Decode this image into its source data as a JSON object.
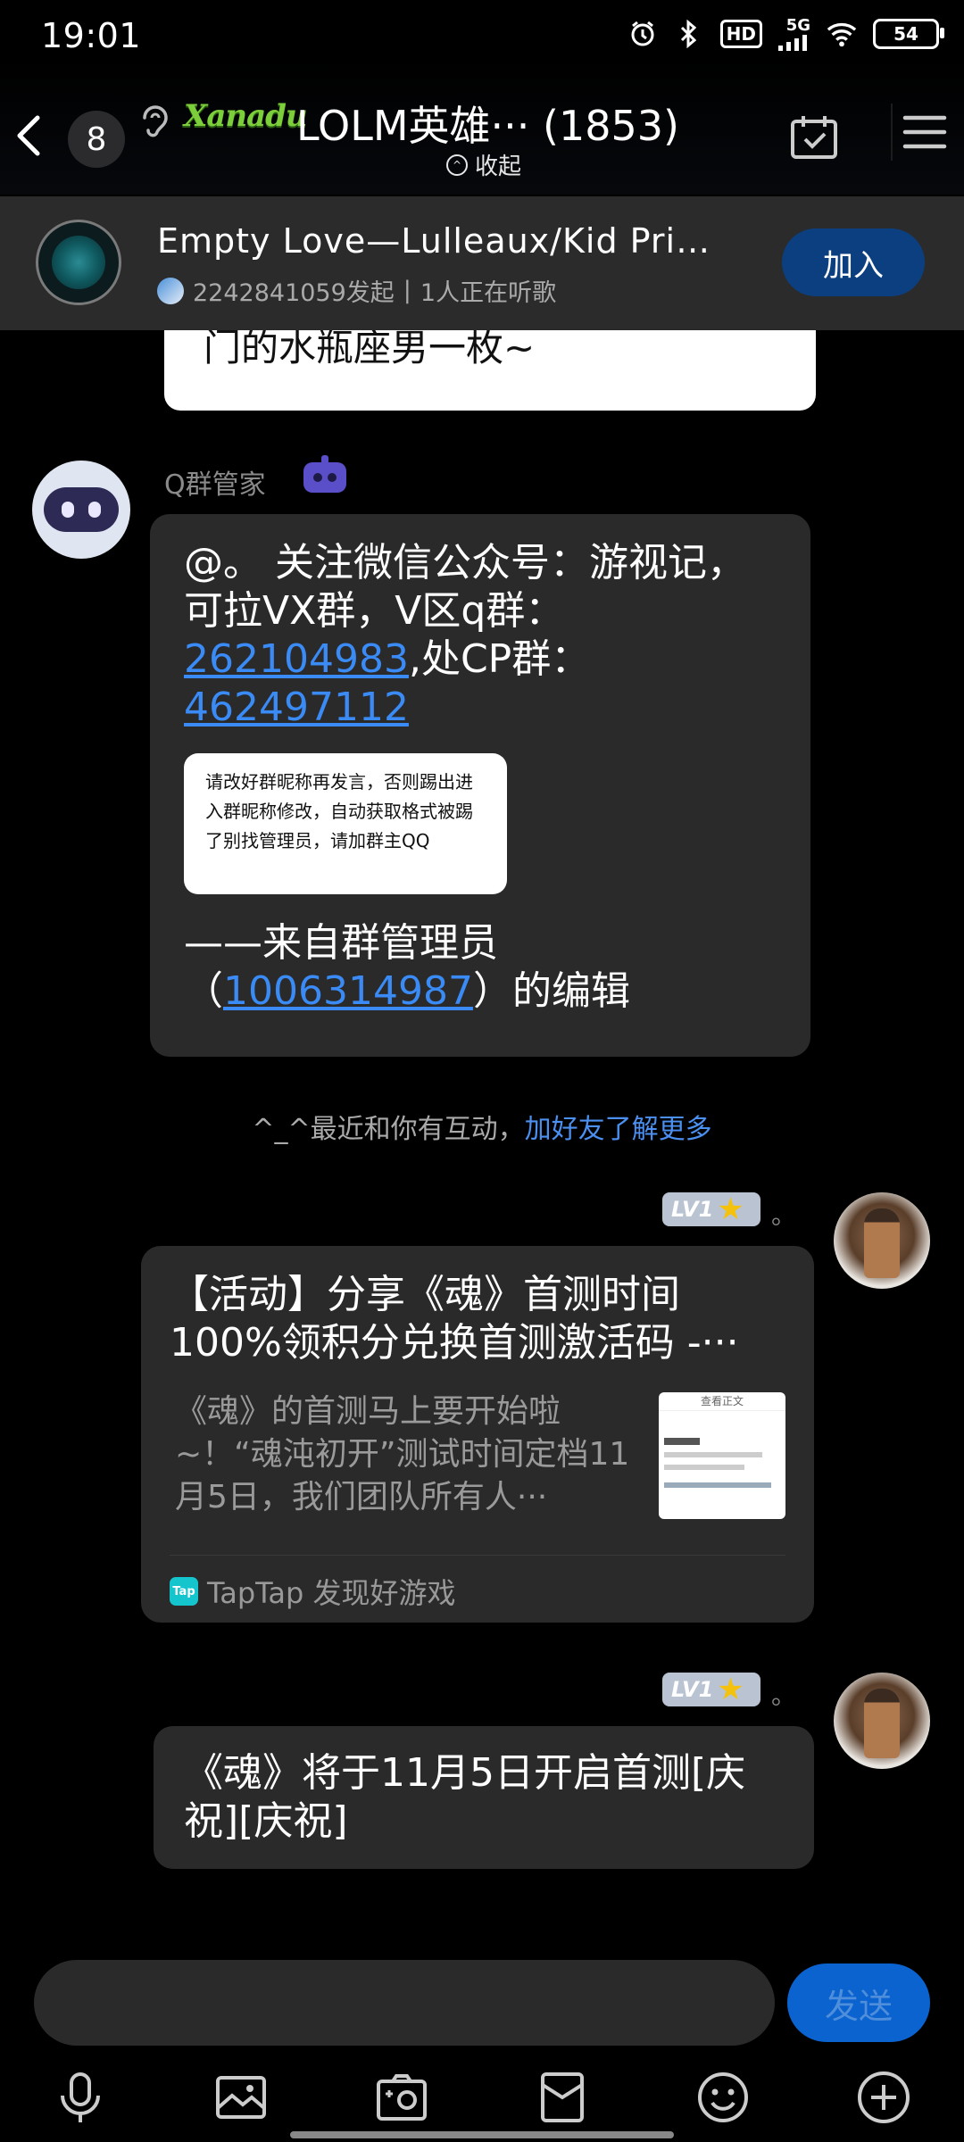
{
  "status_bar": {
    "time": "19:01",
    "hd": "HD",
    "network": "5G",
    "battery": "54"
  },
  "header": {
    "unread_count": "8",
    "group_logo_text": "Xanadu",
    "group_title": "LOLM英雄··· (1853)",
    "collapse_label": "收起"
  },
  "music": {
    "song_title": "Empty Love—Lulleaux/Kid Prin···",
    "initiator": "2242841059发起",
    "separator": "|",
    "listeners": "1人正在听歌",
    "join_label": "加入"
  },
  "previous_message": {
    "text": "门的水瓶座男一枚~"
  },
  "bot_message": {
    "sender": "Q群管家",
    "line1": "@。 关注微信公众号：游视记，可拉VX群，V区q群：",
    "link1": "262104983",
    "mid": ",处CP群：",
    "link2": "462497112",
    "rule_card_text": "请改好群昵称再发言，否则踢出进入群昵称修改，自动获取格式被踢了别找管理员，请加群主QQ",
    "footer_prefix": "——来自群管理员（",
    "footer_link": "1006314987",
    "footer_suffix": "）的编辑"
  },
  "system_tip": {
    "text": "^_^最近和你有互动，",
    "action": "加好友了解更多"
  },
  "my_messages": [
    {
      "level": "LV1",
      "name": "。",
      "share_title": "【活动】分享《魂》首测时间100%领积分兑换首测激活码 -···",
      "share_desc": "《魂》的首测马上要开始啦~！“魂沌初开”测试时间定档11月5日，我们团队所有人···",
      "thumb_header": "查看正文",
      "source_icon": "Tap",
      "source": "TapTap 发现好游戏"
    },
    {
      "level": "LV1",
      "name": "。",
      "text": "《魂》将于11月5日开启首测[庆祝][庆祝]"
    }
  ],
  "input": {
    "value": "",
    "send_label": "发送"
  },
  "toolbar_icons": [
    "microphone-icon",
    "image-icon",
    "camera-icon",
    "red-packet-icon",
    "emoji-icon",
    "plus-icon"
  ],
  "colors": {
    "background": "#000000",
    "bubble": "#2a2a2a",
    "link": "#3a8bf5",
    "join_button": "#0c3f80",
    "send_button": "#0b63cf"
  }
}
